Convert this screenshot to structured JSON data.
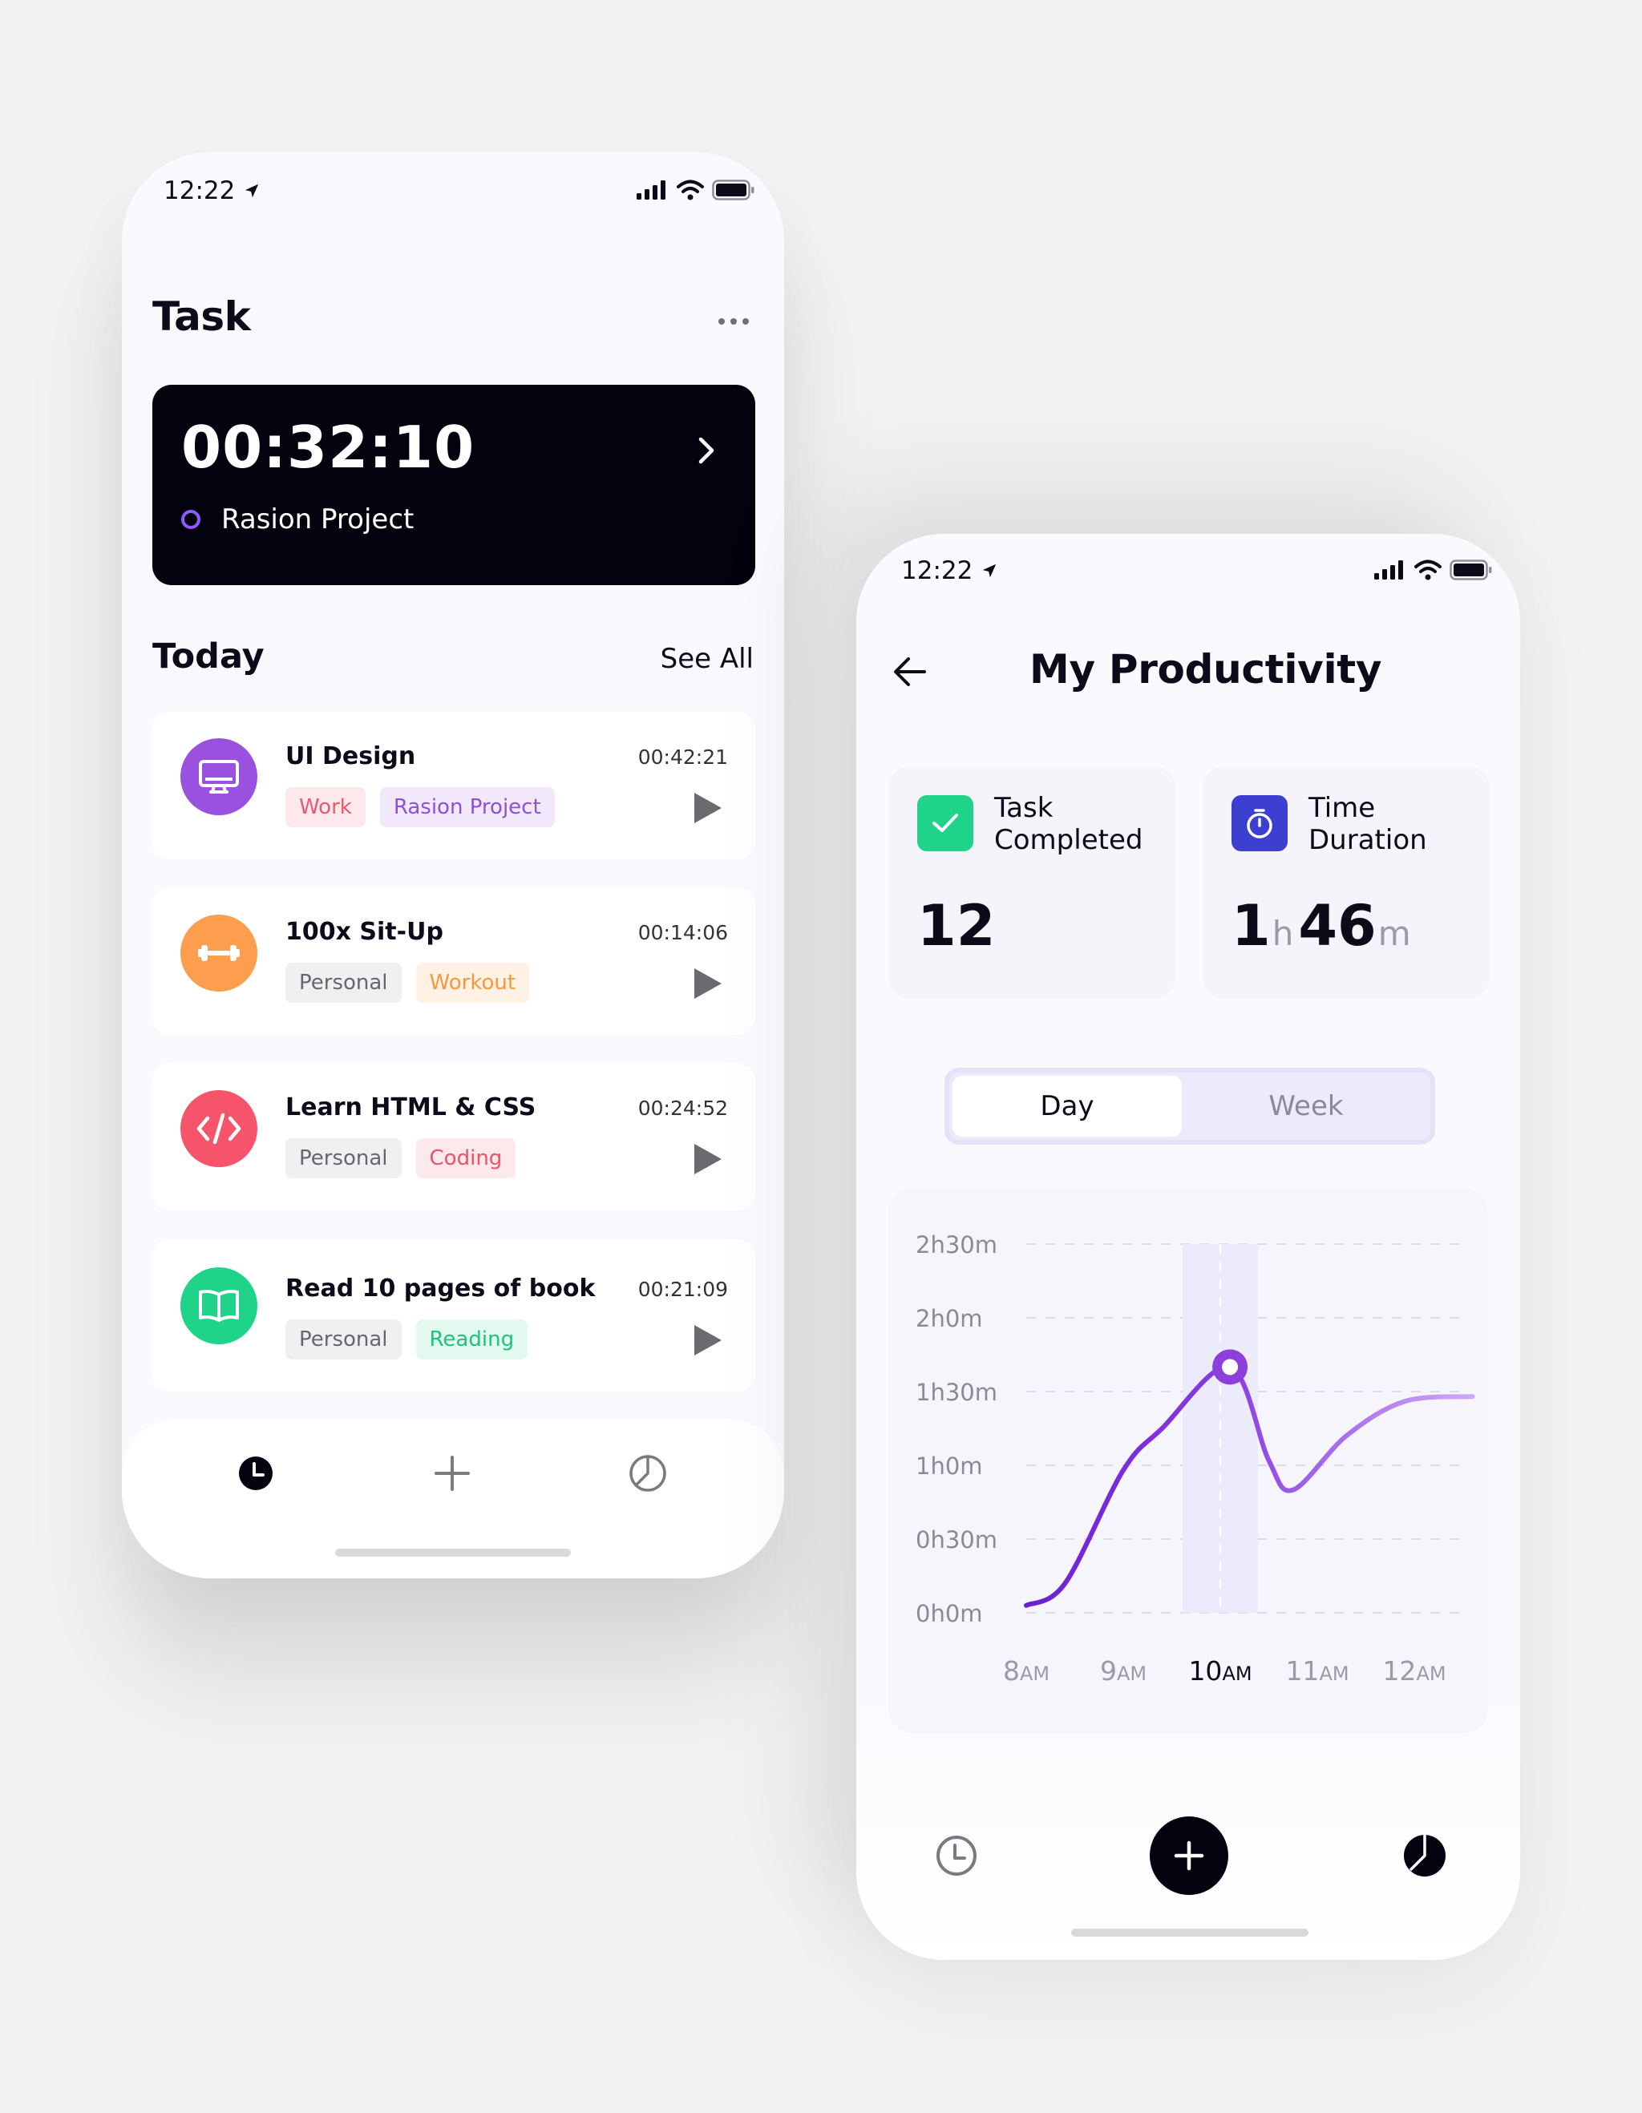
{
  "phone1": {
    "status": {
      "time": "12:22"
    },
    "header": {
      "title": "Task"
    },
    "timer": {
      "value": "00:32:10",
      "project": "Rasion Project"
    },
    "today": {
      "title": "Today",
      "see_all": "See All",
      "tasks": [
        {
          "name": "UI Design",
          "time": "00:42:21",
          "icon": "monitor-icon",
          "color": "#9b51e0",
          "tags": [
            {
              "label": "Work",
              "fg": "#e85a6b",
              "bg": "#fde9ec"
            },
            {
              "label": "Rasion Project",
              "fg": "#8f4fd6",
              "bg": "#f1e8fc"
            }
          ]
        },
        {
          "name": "100x Sit-Up",
          "time": "00:14:06",
          "icon": "dumbbell-icon",
          "color": "#fd9e4f",
          "tags": [
            {
              "label": "Personal",
              "fg": "#666670",
              "bg": "#f0f0f1"
            },
            {
              "label": "Workout",
              "fg": "#f29a3c",
              "bg": "#fff1e4"
            }
          ]
        },
        {
          "name": "Learn HTML & CSS",
          "time": "00:24:52",
          "icon": "code-icon",
          "color": "#f6546a",
          "tags": [
            {
              "label": "Personal",
              "fg": "#666670",
              "bg": "#f0f0f1"
            },
            {
              "label": "Coding",
              "fg": "#ef5168",
              "bg": "#fde8eb"
            }
          ]
        },
        {
          "name": "Read 10 pages of book",
          "time": "00:21:09",
          "icon": "book-icon",
          "color": "#1fd388",
          "tags": [
            {
              "label": "Personal",
              "fg": "#666670",
              "bg": "#f0f0f1"
            },
            {
              "label": "Reading",
              "fg": "#1bc47c",
              "bg": "#e3f8ee"
            }
          ]
        }
      ]
    }
  },
  "phone2": {
    "status": {
      "time": "12:22"
    },
    "header": {
      "title": "My Productivity"
    },
    "stats": {
      "task_completed": {
        "label_line1": "Task",
        "label_line2": "Completed",
        "value": "12"
      },
      "time_duration": {
        "label_line1": "Time",
        "label_line2": "Duration",
        "hours": "1",
        "h_unit": "h",
        "minutes": "46",
        "m_unit": "m"
      }
    },
    "segment": {
      "day": "Day",
      "week": "Week",
      "selected": "Day"
    }
  },
  "chart_data": {
    "type": "line",
    "y_ticks": [
      "2h30m",
      "2h0m",
      "1h30m",
      "1h0m",
      "0h30m",
      "0h0m"
    ],
    "x_ticks": [
      {
        "main": "8",
        "suffix": "AM"
      },
      {
        "main": "9",
        "suffix": "AM"
      },
      {
        "main": "10",
        "suffix": "AM"
      },
      {
        "main": "11",
        "suffix": "AM"
      },
      {
        "main": "12",
        "suffix": "AM"
      }
    ],
    "highlight_index": 2,
    "ylim_minutes": [
      0,
      150
    ],
    "points_minutes": [
      [
        0.0,
        3
      ],
      [
        0.4,
        12
      ],
      [
        1.0,
        58
      ],
      [
        1.4,
        75
      ],
      [
        2.1,
        100
      ],
      [
        2.5,
        62
      ],
      [
        2.75,
        50
      ],
      [
        3.3,
        72
      ],
      [
        3.9,
        86
      ],
      [
        4.6,
        88
      ]
    ],
    "marker": {
      "x": 2.1,
      "y_minutes": 100
    },
    "colors": {
      "line_start": "#6a1fd1",
      "line_end": "#c8a6f5",
      "highlight_band": "#ecebfb",
      "marker": "#8e3fdb"
    }
  }
}
